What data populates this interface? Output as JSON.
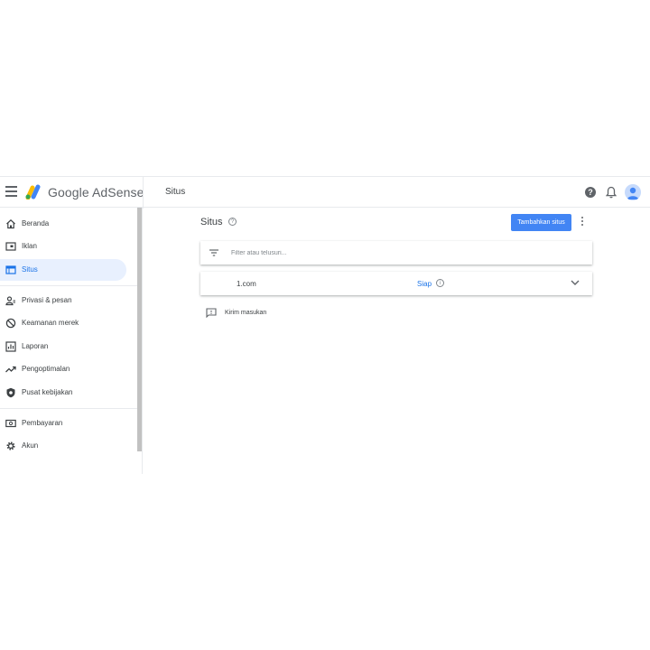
{
  "header": {
    "app_name": "Google AdSense",
    "page_title": "Situs",
    "help_glyph": "?",
    "icons": [
      "menu-icon",
      "adsense-logo",
      "help-icon",
      "bell-icon",
      "avatar"
    ]
  },
  "sidebar": {
    "items": [
      {
        "label": "Beranda",
        "icon": "home-icon"
      },
      {
        "label": "Iklan",
        "icon": "ads-icon"
      },
      {
        "label": "Situs",
        "icon": "sites-icon",
        "active": true
      },
      {
        "label": "Privasi & pesan",
        "icon": "privacy-icon"
      },
      {
        "label": "Keamanan merek",
        "icon": "block-icon"
      },
      {
        "label": "Laporan",
        "icon": "reports-icon"
      },
      {
        "label": "Pengoptimalan",
        "icon": "trending-icon"
      },
      {
        "label": "Pusat kebijakan",
        "icon": "shield-icon"
      },
      {
        "label": "Pembayaran",
        "icon": "payments-icon"
      },
      {
        "label": "Akun",
        "icon": "settings-icon"
      }
    ]
  },
  "main": {
    "title": "Situs",
    "help_glyph": "?",
    "add_site_label": "Tambahkan situs",
    "filter_placeholder": "Filter atau telusuri...",
    "sites": [
      {
        "name": "1.com",
        "status": "Siap",
        "info_glyph": "i"
      }
    ],
    "feedback_label": "Kirim masukan"
  },
  "colors": {
    "accent": "#1a73e8",
    "button": "#4285f4",
    "active_nav_bg": "#e8f0fe",
    "icon_gray": "#5f6368"
  }
}
